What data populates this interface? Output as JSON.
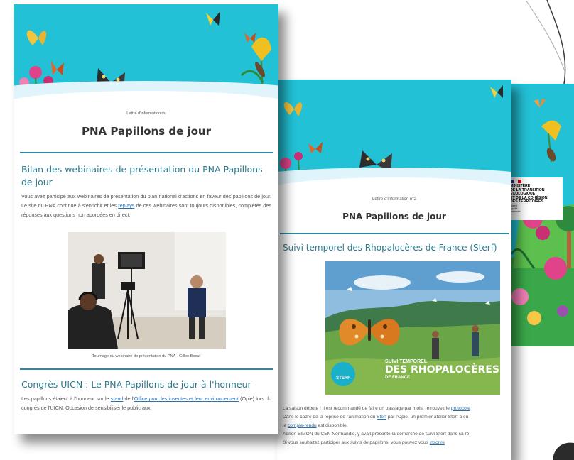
{
  "newsletter1": {
    "kicker": "Lettre d'information du",
    "title": "PNA Papillons de jour",
    "section1_heading": "Bilan des webinaires de présentation du PNA Papillons de jour",
    "section1_body_a": "Vous avez participé aux webinaires de présentation du plan national d'actions en faveur des papillons de jour. Le site du PNA continue à s'enrichir et les ",
    "section1_link": "replays",
    "section1_body_b": " de ces webinaires sont toujours disponibles, complétés des réponses aux questions non abordées en direct.",
    "photo_caption": "Tournage du webinaire de présentation du PNA - Gilles Boeuf",
    "section2_heading": "Congrès UICN : Le PNA Papillons de jour à l'honneur",
    "section2_body_a": "Les papillons étaient à l'honneur sur le ",
    "section2_link1": "stand",
    "section2_body_b": " de l'",
    "section2_link2": "Office pour les insectes et leur environnement",
    "section2_body_c": " (Opie) lors du congrès de l'UICN. Occasion de sensibiliser le public aux"
  },
  "newsletter2": {
    "kicker": "Lettre d'information n°2",
    "title": "PNA Papillons de jour",
    "section_heading": "Suivi temporel des Rhopalocères de France (Sterf)",
    "image_badge": "STERF",
    "image_text_small": "SUIVI TEMPOREL",
    "image_text_big": "DES RHOPALOCÈRES",
    "image_text_sub": "DE FRANCE",
    "p1_a": "La saison débute ! Il est recommandé de faire un passage par mois, retrouvez le ",
    "p1_link": "protocole",
    "p2_a": "Dans le cadre de la reprise de l'animation du ",
    "p2_link": "Sterf",
    "p2_b": " par l'Opie, un premier atelier Sterf a eu",
    "p3_a": "le ",
    "p3_link": "compte-rendu",
    "p3_b": " est disponible.",
    "p4": "Adrien SIMON du CEN Normandie, y avait présenté la démarche de suivi Sterf dans sa ré",
    "p5_a": "Si vous souhaitez participer aux suivis de papillons, vous pouvez vous ",
    "p5_link": "inscrire"
  },
  "newsletter3": {
    "ministry_lines": [
      "MINISTÈRE",
      "DE LA TRANSITION",
      "ÉCOLOGIQUE",
      "ET DE LA COHÉSION",
      "DES TERRITOIRES"
    ],
    "motto_lines": [
      "Liberté",
      "Égalité",
      "Fraternité"
    ]
  },
  "colors": {
    "sky": "#23c1d6",
    "heading": "#2d7a8c",
    "rule": "#2d8a9e",
    "link": "#2a6fb0"
  }
}
